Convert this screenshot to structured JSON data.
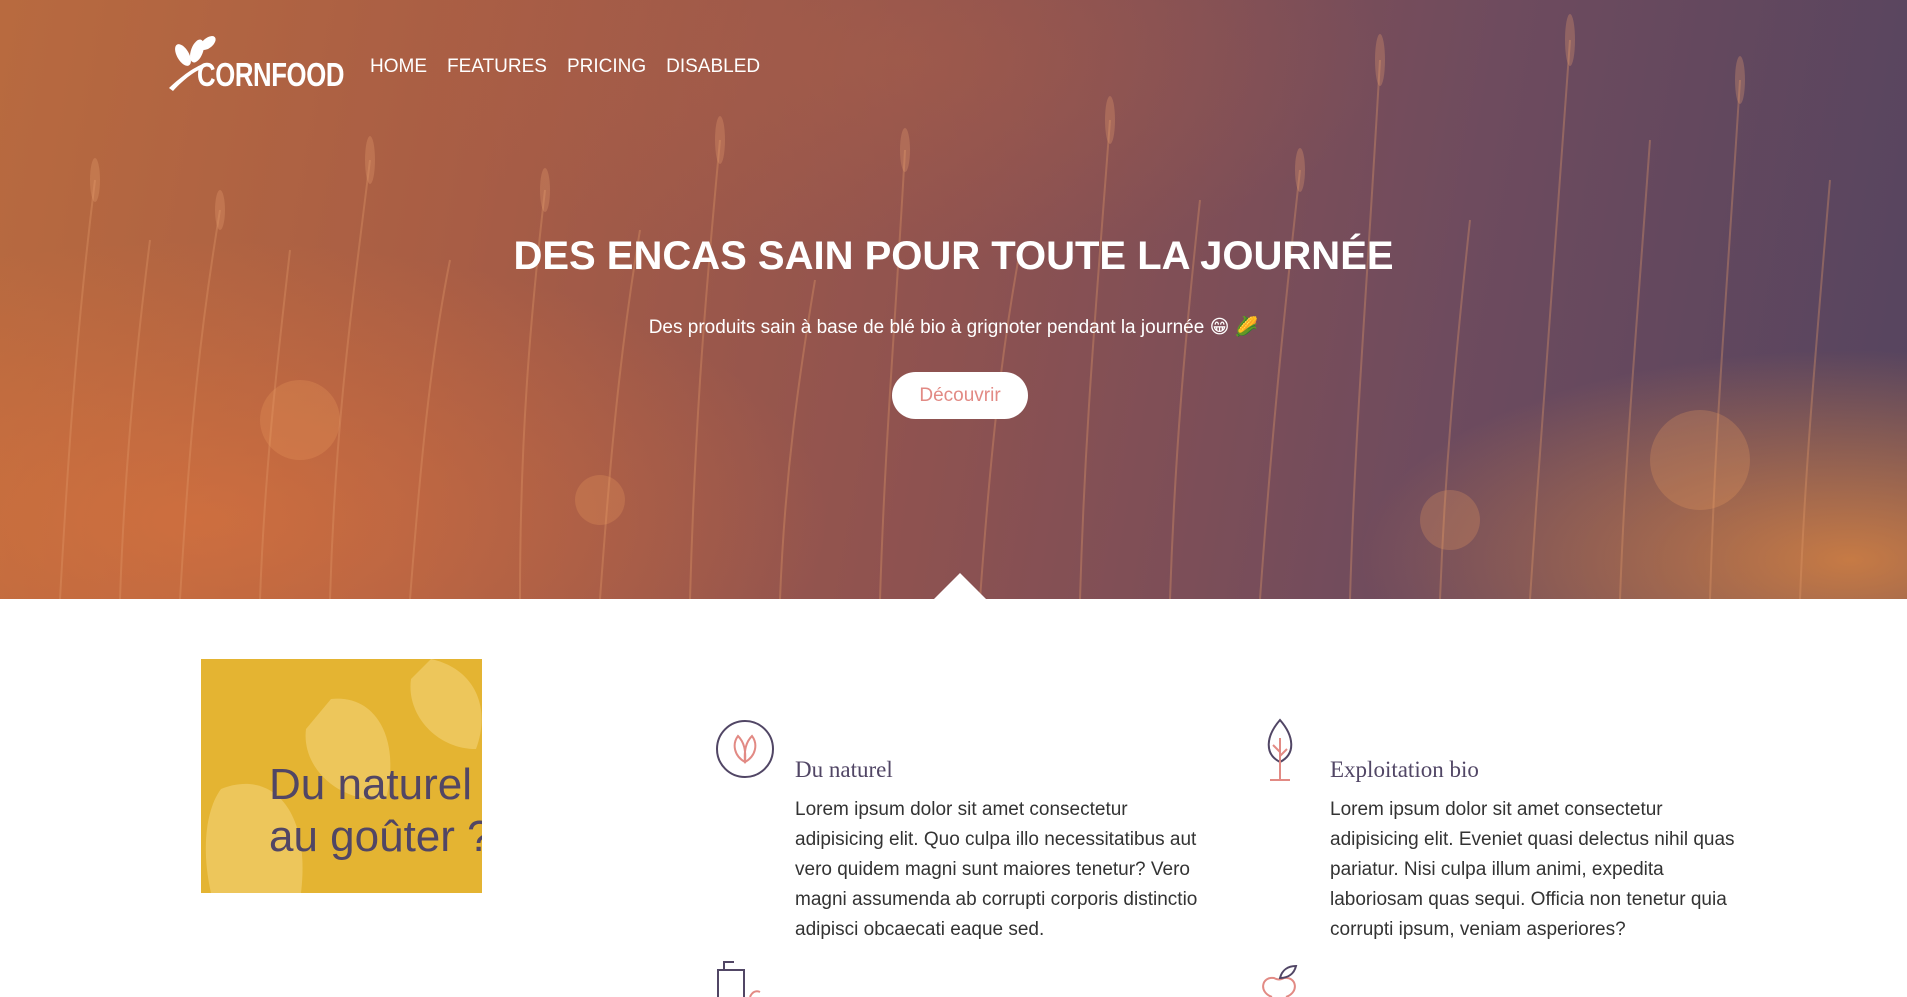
{
  "brand": {
    "name": "CORNFOOD",
    "logo_icon": "wheat-leaf-icon"
  },
  "nav": {
    "items": [
      {
        "label": "HOME"
      },
      {
        "label": "FEATURES"
      },
      {
        "label": "PRICING"
      },
      {
        "label": "DISABLED"
      }
    ]
  },
  "hero": {
    "title": "DES ENCAS SAIN POUR TOUTE LA JOURNÉE",
    "subtitle": "Des produits sain à base de blé bio à grignoter pendant la journée 😁 🌽",
    "cta_label": "Découvrir"
  },
  "promo": {
    "title": "Du naturel au goûter ?",
    "color": "#e4b432"
  },
  "features": [
    {
      "title": "Du naturel",
      "text": "Lorem ipsum dolor sit amet consectetur adipisicing elit. Quo culpa illo necessitatibus aut vero quidem magni sunt maiores tenetur? Vero magni assumenda ab corrupti corporis distinctio adipisci obcaecati eaque sed.",
      "icon": "leaf-circle-icon"
    },
    {
      "title": "Exploitation bio",
      "text": "Lorem ipsum dolor sit amet consectetur adipisicing elit. Eveniet quasi delectus nihil quas pariatur. Nisi culpa illum animi, expedita laboriosam quas sequi. Officia non tenetur quia corrupti ipsum, veniam asperiores?",
      "icon": "tree-icon"
    }
  ],
  "colors": {
    "accent": "#e28a84",
    "heading": "#514665",
    "promo_bg": "#e4b432"
  }
}
